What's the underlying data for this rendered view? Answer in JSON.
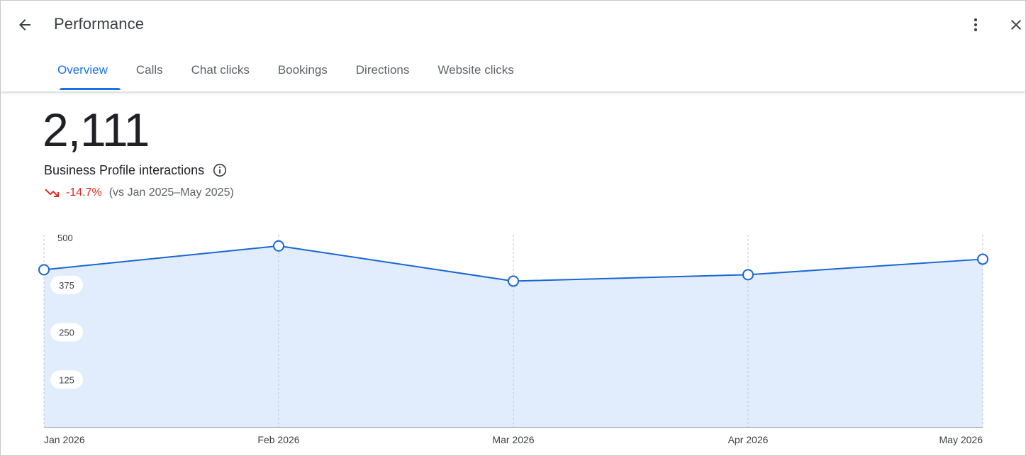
{
  "header": {
    "title": "Performance",
    "icons": {
      "back": "arrow-back-icon",
      "more": "more-vert-icon",
      "close": "close-icon"
    }
  },
  "tabs": [
    {
      "label": "Overview",
      "active": true
    },
    {
      "label": "Calls",
      "active": false
    },
    {
      "label": "Chat clicks",
      "active": false
    },
    {
      "label": "Bookings",
      "active": false
    },
    {
      "label": "Directions",
      "active": false
    },
    {
      "label": "Website clicks",
      "active": false
    }
  ],
  "summary": {
    "total": "2,111",
    "label": "Business Profile interactions",
    "change": "-14.7%",
    "change_direction": "down",
    "comparison": "(vs Jan 2025–May 2025)"
  },
  "colors": {
    "accent": "#1a73e8",
    "line": "#1967d2",
    "area_fill": "#e1ecfc",
    "negative": "#d93025"
  },
  "chart_data": {
    "type": "area",
    "categories": [
      "Jan 2026",
      "Feb 2026",
      "Mar 2026",
      "Apr 2026",
      "May 2026"
    ],
    "values": [
      415,
      478,
      385,
      402,
      443
    ],
    "ylim": [
      0,
      500
    ],
    "yticks": [
      500,
      375,
      250,
      125
    ],
    "grid": "vertical-dashed",
    "legend": "none"
  }
}
